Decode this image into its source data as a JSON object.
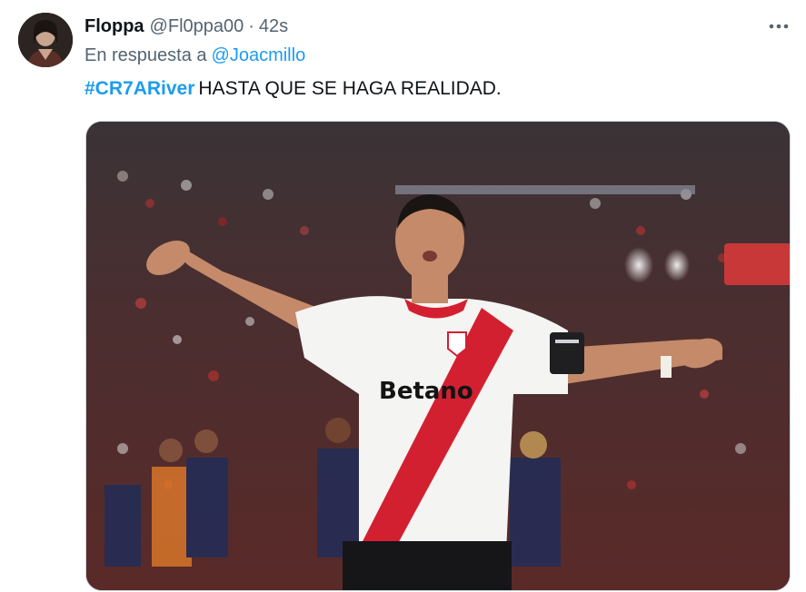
{
  "tweet": {
    "author": {
      "display_name": "Floppa",
      "handle": "@Fl0ppa00",
      "separator": "·",
      "time": "42s",
      "avatar_icon": "user-avatar"
    },
    "reply": {
      "prefix": "En respuesta a",
      "mention": "@Joacmillo"
    },
    "text": {
      "hashtag": "#CR7ARiver",
      "body": "HASTA QUE SE HAGA REALIDAD."
    },
    "more_icon": "more-options-icon",
    "media": {
      "type": "photo",
      "jersey_text": "Betano"
    }
  },
  "colors": {
    "link": "#1d9bf0",
    "text_primary": "#0f1419",
    "text_secondary": "#536471",
    "jersey_red": "#d32031",
    "border": "#cfd9de"
  }
}
